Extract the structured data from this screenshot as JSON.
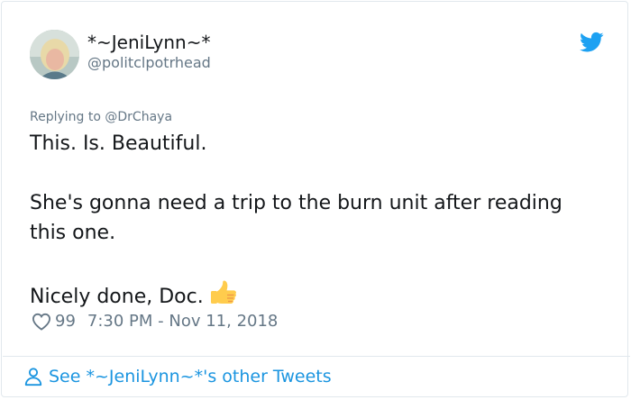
{
  "tweet": {
    "author": {
      "display_name": "*~JeniLynn~*",
      "handle": "@politclpotrhead",
      "avatar_icon": "avatar-photo"
    },
    "reply_prefix": "Replying to",
    "reply_to": "@DrChaya",
    "body": {
      "line1": "This. Is. Beautiful.",
      "line2": "She's gonna need a trip to the burn unit after reading this one.",
      "line3": "Nicely done, Doc.",
      "emoji": "thumbs-up"
    },
    "likes": "99",
    "timestamp": "7:30 PM - Nov 11, 2018"
  },
  "footer": {
    "other_tweets_label": "See *~JeniLynn~*'s other Tweets"
  },
  "colors": {
    "twitter_blue": "#1da1f2",
    "link_blue": "#1b95e0",
    "muted": "#657786",
    "text": "#14171a",
    "border": "#e1e8ed"
  }
}
